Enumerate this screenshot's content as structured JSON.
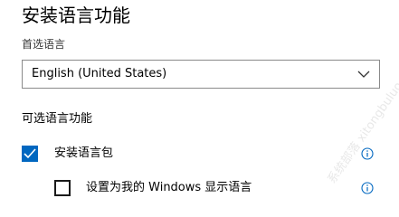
{
  "page": {
    "title": "安装语言功能",
    "preferred_language_label": "首选语言"
  },
  "language_select": {
    "selected_value": "English (United States)",
    "icon": "chevron-down-icon"
  },
  "optional_features": {
    "section_title": "可选语言功能",
    "options": [
      {
        "label": "安装语言包",
        "checked": true,
        "info_icon": "info-icon"
      },
      {
        "label": "设置为我的 Windows 显示语言",
        "checked": false,
        "info_icon": "info-icon"
      }
    ]
  },
  "watermark": {
    "text": "系统部落 xitongbuluo.com"
  },
  "colors": {
    "accent": "#0067c0",
    "border": "#8a8a8a"
  }
}
